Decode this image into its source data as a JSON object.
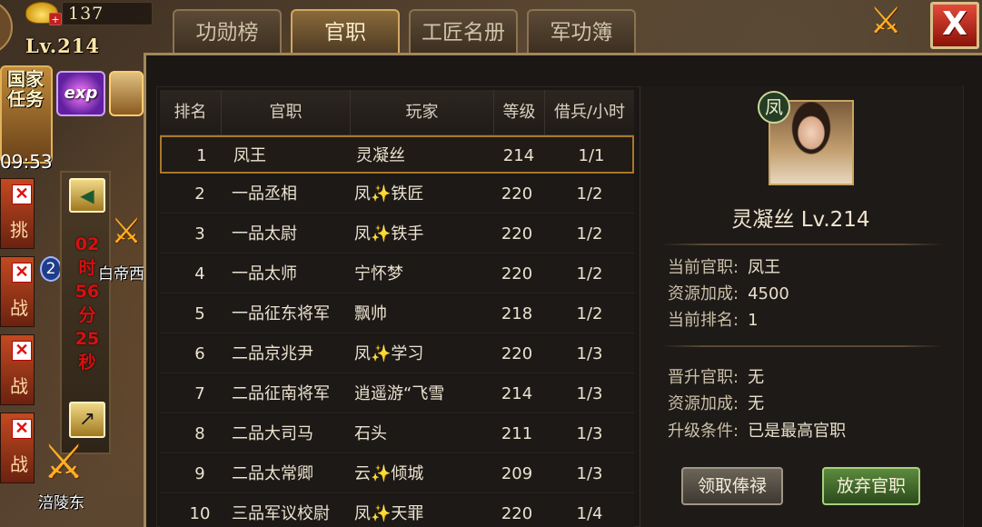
{
  "resources": {
    "gold_count": "137",
    "plus_label": "+",
    "player_level": "Lv.214"
  },
  "side": {
    "quest_label": "国家任务",
    "quest_timer": "09:53",
    "exp_label": "exp",
    "countdown": [
      "02",
      "时",
      "56",
      "分",
      "25",
      "秒"
    ],
    "city_chars": [
      "挑",
      "战",
      "战",
      "战"
    ],
    "city_name_1": "白帝西",
    "city_name_2": "涪陵东",
    "blue_badge": "2"
  },
  "tabs": [
    {
      "label": "功勋榜",
      "active": false
    },
    {
      "label": "官职",
      "active": true
    },
    {
      "label": "工匠名册",
      "active": false
    },
    {
      "label": "军功簿",
      "active": false
    }
  ],
  "table": {
    "headers": [
      "排名",
      "官职",
      "玩家",
      "等级",
      "借兵/小时"
    ],
    "rows": [
      {
        "rank": "1",
        "title": "凤王",
        "player_prefix": "",
        "player": "灵凝丝",
        "level": "214",
        "troops": "1/1"
      },
      {
        "rank": "2",
        "title": "一品丞相",
        "player_prefix": "凤",
        "player": "铁匠",
        "level": "220",
        "troops": "1/2"
      },
      {
        "rank": "3",
        "title": "一品太尉",
        "player_prefix": "凤",
        "player": "铁手",
        "level": "220",
        "troops": "1/2"
      },
      {
        "rank": "4",
        "title": "一品太师",
        "player_prefix": "",
        "player": "宁怀梦",
        "level": "220",
        "troops": "1/2"
      },
      {
        "rank": "5",
        "title": "一品征东将军",
        "player_prefix": "",
        "player": "飘帅",
        "level": "218",
        "troops": "1/2"
      },
      {
        "rank": "6",
        "title": "二品京兆尹",
        "player_prefix": "凤",
        "player": "学习",
        "level": "220",
        "troops": "1/3"
      },
      {
        "rank": "7",
        "title": "二品征南将军",
        "player_prefix": "",
        "player": "逍遥游“飞雪",
        "level": "214",
        "troops": "1/3"
      },
      {
        "rank": "8",
        "title": "二品大司马",
        "player_prefix": "",
        "player": "石头",
        "level": "211",
        "troops": "1/3"
      },
      {
        "rank": "9",
        "title": "二品太常卿",
        "player_prefix": "云",
        "player": "倾城",
        "level": "209",
        "troops": "1/3"
      },
      {
        "rank": "10",
        "title": "三品军议校尉",
        "player_prefix": "凤",
        "player": "天罪",
        "level": "220",
        "troops": "1/4"
      }
    ]
  },
  "detail": {
    "faction": "凤",
    "name_level": "灵凝丝  Lv.214",
    "current_title_label": "当前官职:",
    "current_title": "凤王",
    "bonus_label": "资源加成:",
    "bonus": "4500",
    "rank_label": "当前排名:",
    "rank": "1",
    "next_title_label": "晋升官职:",
    "next_title": "无",
    "next_bonus_label": "资源加成:",
    "next_bonus": "无",
    "upgrade_label": "升级条件:",
    "upgrade": "已是最高官职",
    "collect_button": "领取俸禄",
    "abandon_button": "放弃官职"
  },
  "close_label": "X"
}
